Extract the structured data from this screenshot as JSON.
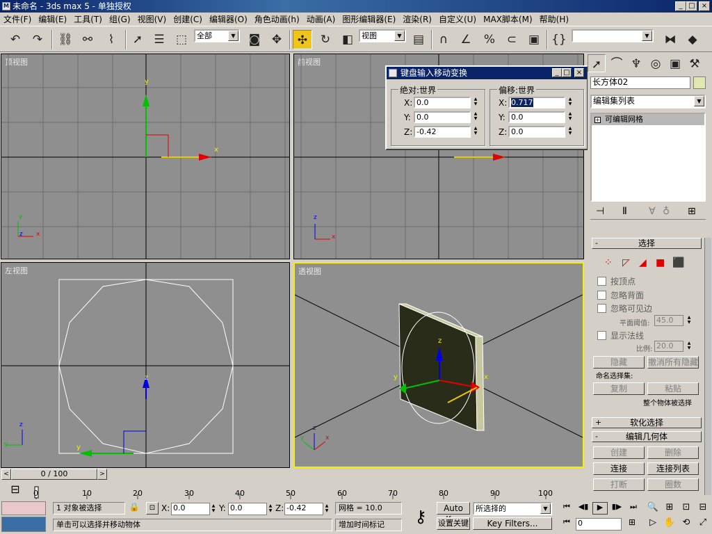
{
  "window": {
    "icon_label": "M",
    "title": "未命名 - 3ds max 5 - 单独授权",
    "min_label": "_",
    "max_label": "□",
    "close_label": "×"
  },
  "menu": [
    "文件(F)",
    "编辑(E)",
    "工具(T)",
    "组(G)",
    "视图(V)",
    "创建(C)",
    "编辑器(O)",
    "角色动画(h)",
    "动画(A)",
    "图形编辑器(E)",
    "渲染(R)",
    "自定义(U)",
    "MAX脚本(M)",
    "帮助(H)"
  ],
  "toolbar": {
    "selection_filter": "全部",
    "coord_system": "视图",
    "named_selection": ""
  },
  "viewports": {
    "top": "顶视图",
    "front": "前视图",
    "left": "左视图",
    "perspective": "透视图"
  },
  "axes": {
    "x": "x",
    "y": "y",
    "z": "z"
  },
  "dialog": {
    "title": "键盘输入移动变换",
    "absolute_label": "绝对:世界",
    "offset_label": "偏移:世界",
    "abs": {
      "x": "0.0",
      "y": "0.0",
      "z": "-0.42"
    },
    "off": {
      "x": "0.717",
      "y": "0.0",
      "z": "0.0"
    },
    "x_label": "X:",
    "y_label": "Y:",
    "z_label": "Z:"
  },
  "command_panel": {
    "object_name": "长方体02",
    "modifier_list": "编辑集列表",
    "stack_item": "可编辑网格",
    "selection_rollout": "选择",
    "by_vertex": "按顶点",
    "ignore_backface": "忽略背面",
    "ignore_visible_edges": "忽略可见边",
    "planar_thresh_label": "平面阈值:",
    "planar_thresh": "45.0",
    "show_normals": "显示法线",
    "scale_label": "比例:",
    "scale": "20.0",
    "hide": "隐藏",
    "unhide_all": "撤消所有隐藏",
    "named_sel_label": "命名选择集:",
    "copy": "复制",
    "paste": "粘贴",
    "whole_object": "整个物体被选择",
    "soft_selection": "软化选择",
    "edit_geometry": "编辑几何体",
    "create": "创建",
    "delete": "删除",
    "attach": "连接",
    "attach_list": "连接列表",
    "break": "打断",
    "chamfer": "圈数"
  },
  "timeline": {
    "frame": "0 / 100",
    "ticks": [
      "0",
      "10",
      "20",
      "30",
      "40",
      "50",
      "60",
      "70",
      "80",
      "90",
      "100"
    ]
  },
  "status": {
    "selected": "1 对象被选择",
    "prompt": "单击可以选择并移动物体",
    "x_label": "X:",
    "x": "0.0",
    "y_label": "Y:",
    "y": "0.0",
    "z_label": "Z:",
    "z": "-0.42",
    "grid": "网格 = 10.0",
    "add_time_tag": "增加时间标记",
    "auto_key": "Auto Key",
    "set_key": "设置关键点",
    "key_mode": "所选择的",
    "key_filters": "Key Filters...",
    "current_frame": "0"
  },
  "colors": {
    "title_bg": "#0a246a",
    "viewport_bg": "#8f8f8f",
    "active_border": "#f6f000",
    "move_button": "#f0c419"
  }
}
